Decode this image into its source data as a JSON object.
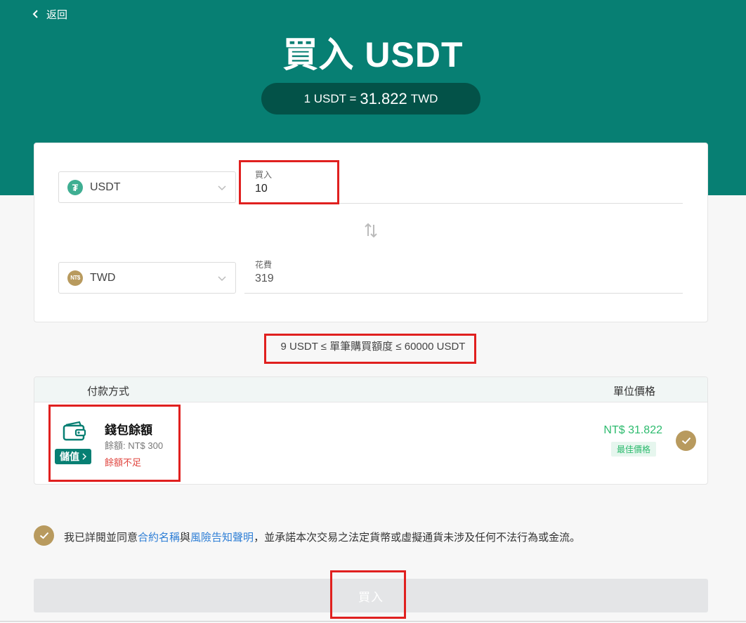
{
  "header": {
    "back_label": "返回",
    "title": "買入 USDT",
    "rate": {
      "prefix": "1 USDT = ",
      "value": "31.822",
      "suffix": " TWD"
    }
  },
  "trade": {
    "buy_currency": "USDT",
    "buy_label": "買入",
    "buy_value": "10",
    "spend_currency": "TWD",
    "spend_label": "花費",
    "spend_value": "319",
    "twd_coin_glyph": "NT$"
  },
  "limit_text": "9 USDT ≤ 單筆購買額度 ≤ 60000 USDT",
  "payment": {
    "col_method": "付款方式",
    "col_price": "單位價格",
    "method_name": "錢包餘額",
    "balance": "餘額: NT$ 300",
    "insufficient": "餘額不足",
    "topup_label": "儲值",
    "price": "NT$ 31.822",
    "best_price_label": "最佳價格",
    "icon": "wallet-icon"
  },
  "agreement": {
    "pre": "我已詳閱並同意",
    "link1": "合約名稱",
    "mid": "與",
    "link2": "風險告知聲明",
    "post": "，並承諾本次交易之法定貨幣或虛擬通貨未涉及任何不法行為或金流。"
  },
  "buy_button_label": "買入",
  "colors": {
    "brand": "#077f73",
    "pill": "#035248",
    "gold": "#b89a5e",
    "green_price": "#2dbb6e",
    "error": "#e0443e",
    "link": "#2f7fd6",
    "highlight": "#e0201f"
  }
}
